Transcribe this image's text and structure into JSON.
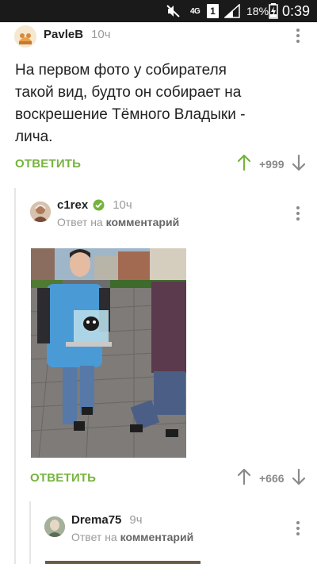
{
  "status_bar": {
    "network": "4G",
    "sim": "1",
    "battery_percent": "18%",
    "time": "0:39"
  },
  "comments": [
    {
      "username": "PavleB",
      "time": "10ч",
      "text_lines": [
        "На первом фото у собирателя",
        "такой вид, будто он собирает на",
        "воскрешение Тёмного Владыки -",
        "лича."
      ],
      "reply_label": "ОТВЕТИТЬ",
      "rating": "+999"
    },
    {
      "username": "c1rex",
      "time": "10ч",
      "verified": true,
      "reply_to_prefix": "Ответ на",
      "reply_to_link": "комментарий",
      "reply_label": "ОТВЕТИТЬ",
      "rating": "+666"
    },
    {
      "username": "Drema75",
      "time": "9ч",
      "reply_to_prefix": "Ответ на",
      "reply_to_link": "комментарий"
    }
  ],
  "colors": {
    "accent_green": "#76b33e",
    "muted_gray": "#9a9a9a",
    "status_bar": "#1a1a1a"
  }
}
